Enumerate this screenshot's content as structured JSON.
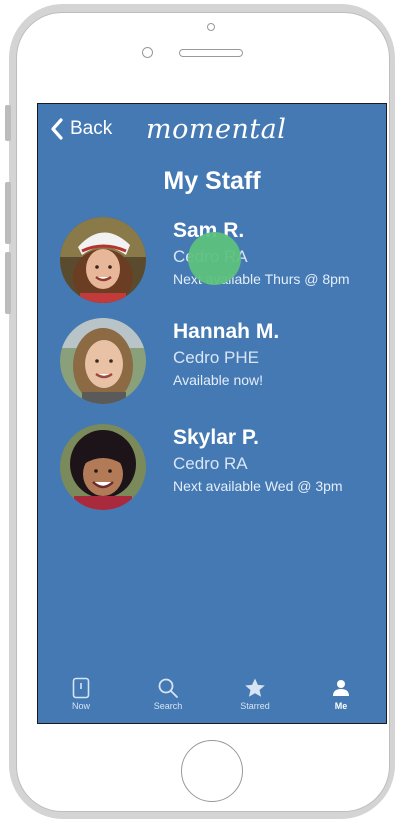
{
  "header": {
    "back_label": "Back",
    "brand": "momental"
  },
  "page": {
    "title": "My Staff"
  },
  "staff": [
    {
      "name": "Sam R.",
      "role": "Cedro RA",
      "availability": "Next available Thurs @ 8pm",
      "avatar": "avatar-sam"
    },
    {
      "name": "Hannah M.",
      "role": "Cedro PHE",
      "availability": "Available now!",
      "avatar": "avatar-hannah"
    },
    {
      "name": "Skylar P.",
      "role": "Cedro RA",
      "availability": "Next available Wed @ 3pm",
      "avatar": "avatar-skylar"
    }
  ],
  "tabbar": {
    "items": [
      {
        "label": "Now",
        "icon": "phone-icon"
      },
      {
        "label": "Search",
        "icon": "search-icon"
      },
      {
        "label": "Starred",
        "icon": "star-icon"
      },
      {
        "label": "Me",
        "icon": "person-icon"
      }
    ],
    "active": "Me"
  },
  "colors": {
    "screen_background": "#4479b3",
    "touch_indicator": "#5ec17e",
    "text": "#ffffff"
  }
}
